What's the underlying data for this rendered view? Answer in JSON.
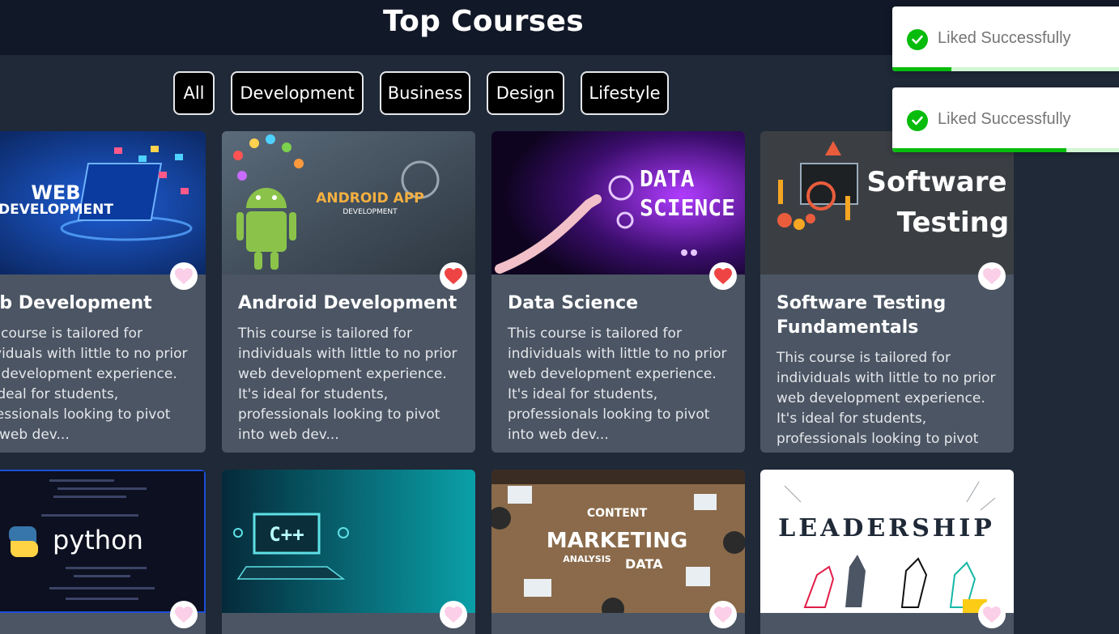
{
  "header": {
    "title": "Top Courses"
  },
  "filters": [
    "All",
    "Development",
    "Business",
    "Design",
    "Lifestyle"
  ],
  "courses": [
    {
      "title": "Web Development",
      "description": "This course is tailored for individuals with little to no prior web development experience. It's ideal for students, professionals looking to pivot into web dev...",
      "liked": false,
      "image_text": [
        "WEB",
        "DEVELOPMENT"
      ]
    },
    {
      "title": "Android Development",
      "description": "This course is tailored for individuals with little to no prior web development experience. It's ideal for students, professionals looking to pivot into web dev...",
      "liked": true,
      "image_text": [
        "ANDROID APP",
        "DEVELOPMENT"
      ]
    },
    {
      "title": "Data Science",
      "description": "This course is tailored for individuals with little to no prior web development experience. It's ideal for students, professionals looking to pivot into web dev...",
      "liked": true,
      "image_text": [
        "DATA",
        "SCIENCE"
      ]
    },
    {
      "title": "Software Testing Fundamentals",
      "description": "This course is tailored for individuals with little to no prior web development experience. It's ideal for students, professionals looking to pivot into web dev...",
      "liked": false,
      "image_text": [
        "Software",
        "Testing"
      ]
    },
    {
      "liked": false,
      "image_text": [
        "python"
      ]
    },
    {
      "liked": false,
      "image_text": [
        "C++"
      ]
    },
    {
      "liked": false,
      "image_text": [
        "MARKETING",
        "DATA",
        "ANALYSIS",
        "CONTENT"
      ]
    },
    {
      "liked": false,
      "image_text": [
        "LEADERSHIP"
      ]
    }
  ],
  "toasts": [
    {
      "message": "Liked Successfully",
      "progress": 0.25
    },
    {
      "message": "Liked Successfully",
      "progress": 0.74
    }
  ],
  "colors": {
    "page_bg": "#1f2937",
    "header_bg": "#111827",
    "card_bg": "#4b5563",
    "heart_liked": "#ef4444",
    "heart_unliked": "#fbcfe8",
    "toast_green": "#07bc0c"
  },
  "icons": {
    "heart": "heart-icon",
    "check": "check-circle-icon"
  }
}
